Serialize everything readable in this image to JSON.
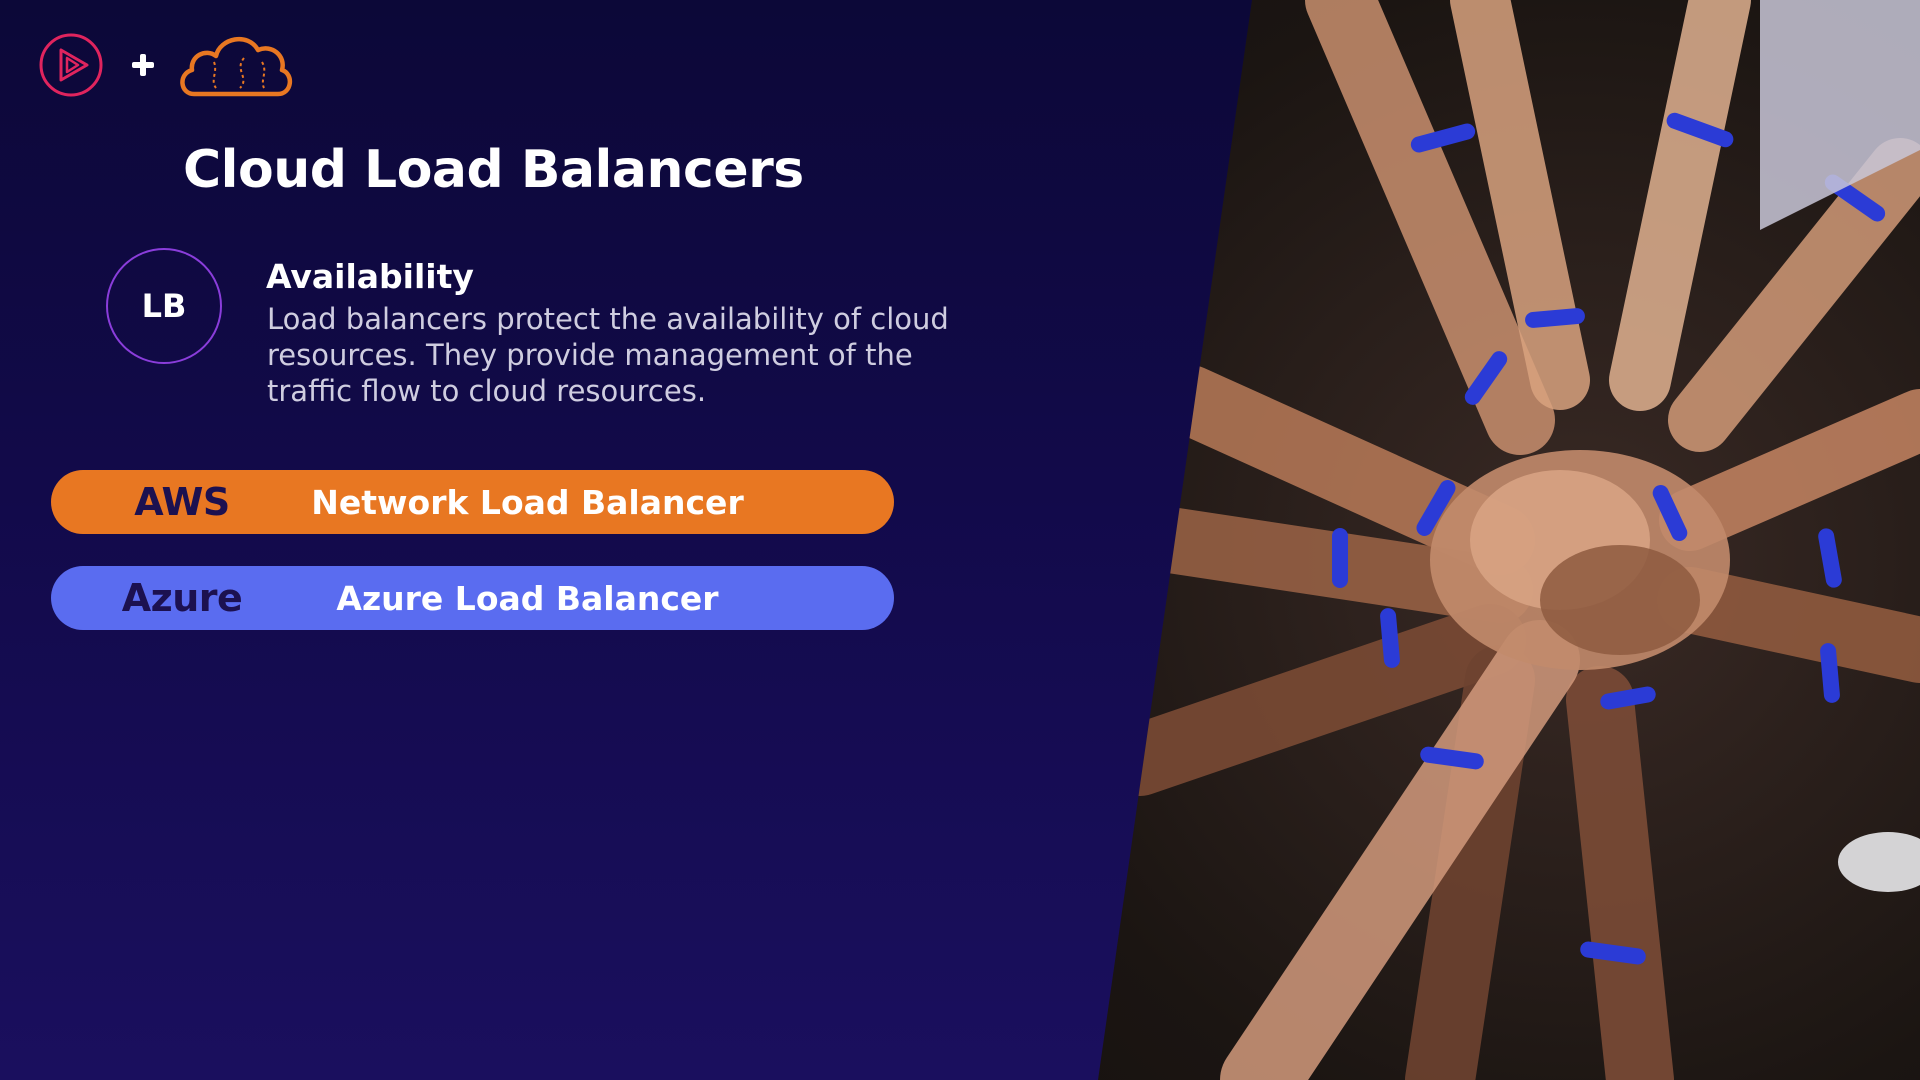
{
  "slide": {
    "title": "Cloud Load Balancers",
    "logos": {
      "primary": "play-logo-icon",
      "separator": "+",
      "secondary": "cloud-logo-icon"
    },
    "availability": {
      "badge": "LB",
      "heading": "Availability",
      "body_lines": [
        "Load balancers protect the availability of cloud",
        "resources. They provide management of the",
        "traffic flow to cloud resources."
      ]
    },
    "providers": [
      {
        "provider": "AWS",
        "service": "Network Load Balancer",
        "color": "#e87722"
      },
      {
        "provider": "Azure",
        "service": "Azure Load Balancer",
        "color": "#5a6cf0"
      }
    ],
    "photo": "hands-together-photo"
  },
  "colors": {
    "background": "#0c0838",
    "accent_pink": "#e0245e",
    "accent_orange": "#e87722",
    "accent_blue": "#5a6cf0",
    "circle_border": "#8a3ddb"
  }
}
